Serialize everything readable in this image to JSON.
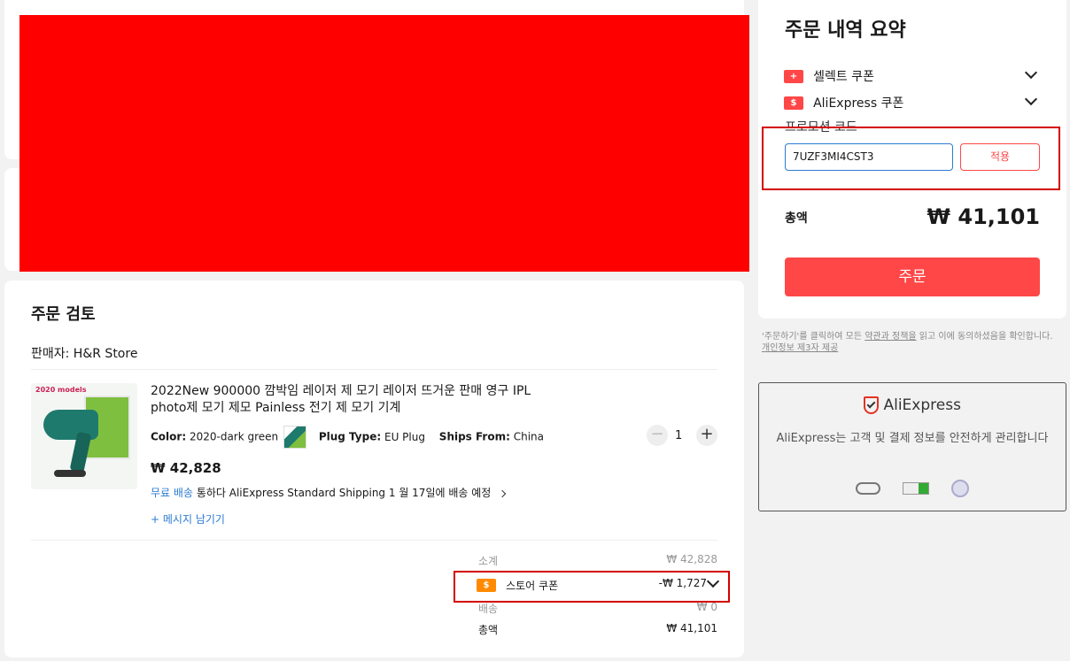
{
  "summary": {
    "title": "주문 내역 요약",
    "select_coupon_label": "셀렉트 쿠폰",
    "aliexpress_coupon_label": "AliExpress 쿠폰",
    "promo_code_label": "프로모션 코드",
    "promo_code_value": "7UZF3MI4CST3",
    "apply_label": "적용",
    "total_label": "총액",
    "total_value": "₩ 41,101",
    "order_button_label": "주문"
  },
  "terms": {
    "line1_prefix": "'주문하기'를 클릭하여 모든 ",
    "policy_link": "약관과 정책을",
    "line1_suffix": " 읽고 이에 동의하셨음을 확인합니다.",
    "privacy_link": "개인정보 제3자 제공"
  },
  "security": {
    "brand": "AliExpress",
    "message": "AliExpress는 고객 및 결제 정보를 안전하게 관리합니다"
  },
  "review": {
    "title": "주문 검토",
    "seller": "판매자: H&R Store",
    "product": {
      "image_label": "2020 models",
      "title": "2022New 900000 깜박임 레이저 제 모기 레이저 뜨거운 판매 영구 IPL photo제 모기 제모 Painless 전기 제 모기 기계",
      "color_label": "Color:",
      "color_value": "2020-dark green",
      "plug_label": "Plug Type:",
      "plug_value": "EU Plug",
      "ships_label": "Ships From:",
      "ships_value": "China",
      "price": "₩ 42,828",
      "quantity": "1",
      "free_shipping": "무료 배송",
      "shipping_text": "통하다 AliExpress Standard Shipping 1 월 17일에 배송 예정",
      "leave_message": "메시지 남기기"
    },
    "totals": {
      "subtotal_label": "소계",
      "subtotal_value": "₩ 42,828",
      "store_coupon_label": "스토어 쿠폰",
      "store_coupon_value": "-₩ 1,727",
      "shipping_label": "배송",
      "shipping_value": "₩ 0",
      "total_label": "총액",
      "total_value": "₩ 41,101"
    }
  },
  "colors": {
    "accent": "#ff4747",
    "highlight_box": "#d40000",
    "link": "#2b7bd1"
  }
}
